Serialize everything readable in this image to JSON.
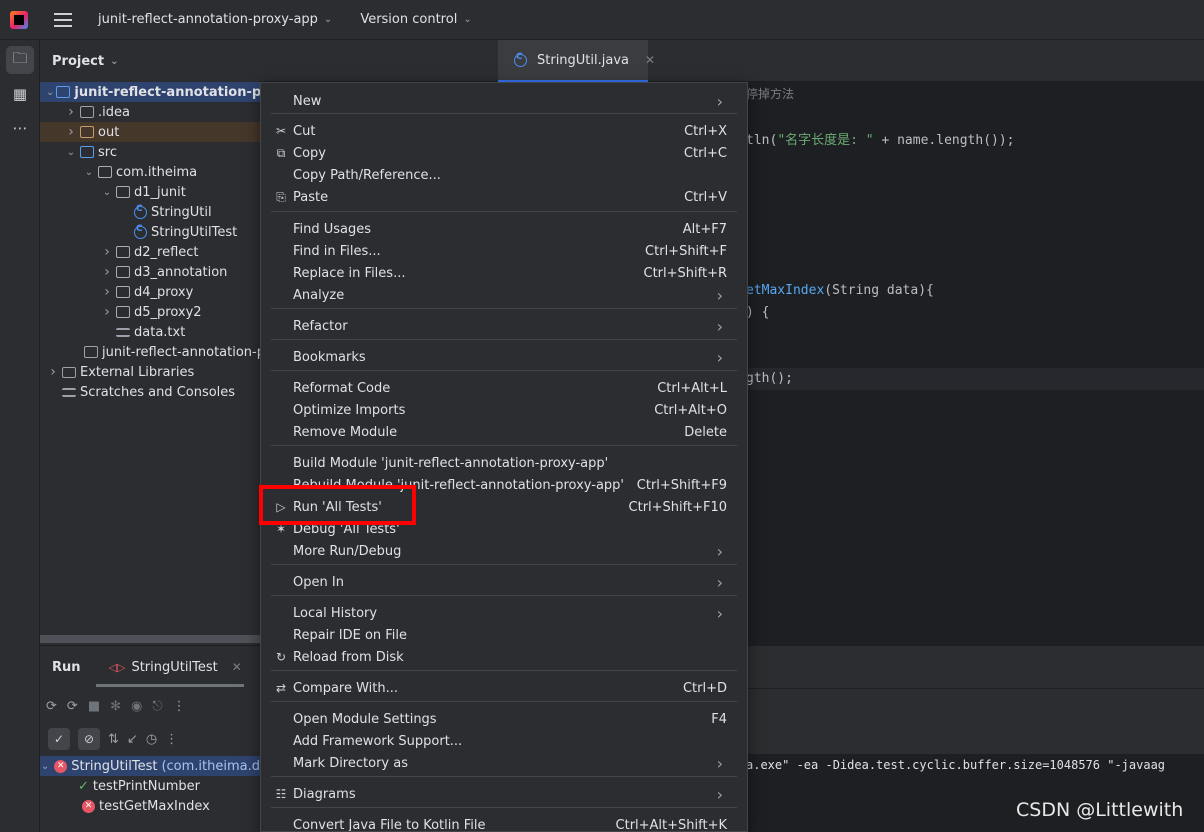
{
  "topbar": {
    "project_name": "junit-reflect-annotation-proxy-app",
    "vcs_label": "Version control"
  },
  "project_panel": {
    "title": "Project",
    "tree": [
      {
        "label": "junit-reflect-annotation-p",
        "depth": 0,
        "expanded": true,
        "icon": "module-folder-icon",
        "selected": true
      },
      {
        "label": ".idea",
        "depth": 1,
        "expanded": false,
        "icon": "folder-icon"
      },
      {
        "label": "out",
        "depth": 1,
        "expanded": false,
        "icon": "folder-orange-icon",
        "highlight": true
      },
      {
        "label": "src",
        "depth": 1,
        "expanded": true,
        "icon": "source-folder-icon"
      },
      {
        "label": "com.itheima",
        "depth": 2,
        "expanded": true,
        "icon": "package-icon"
      },
      {
        "label": "d1_junit",
        "depth": 3,
        "expanded": true,
        "icon": "package-icon"
      },
      {
        "label": "StringUtil",
        "depth": 4,
        "icon": "class-icon"
      },
      {
        "label": "StringUtilTest",
        "depth": 4,
        "icon": "class-icon"
      },
      {
        "label": "d2_reflect",
        "depth": 3,
        "expanded": false,
        "icon": "package-icon"
      },
      {
        "label": "d3_annotation",
        "depth": 3,
        "expanded": false,
        "icon": "package-icon"
      },
      {
        "label": "d4_proxy",
        "depth": 3,
        "expanded": false,
        "icon": "package-icon"
      },
      {
        "label": "d5_proxy2",
        "depth": 3,
        "expanded": false,
        "icon": "package-icon"
      },
      {
        "label": "data.txt",
        "depth": 3,
        "icon": "text-file-icon"
      },
      {
        "label": "junit-reflect-annotation-p",
        "depth": 2,
        "icon": "module-file-icon"
      },
      {
        "label": "External Libraries",
        "depth": 0,
        "expanded": false,
        "icon": "library-icon"
      },
      {
        "label": "Scratches and Consoles",
        "depth": 0,
        "icon": "scratches-icon"
      }
    ]
  },
  "editor": {
    "tab_label": "StringUtil.java",
    "code": {
      "line1": "停掉方法",
      "line2_pre": "tln(",
      "line2_str": "\"名字长度是: \"",
      "line2_post": " + name.length());",
      "line3_fn": "etMaxIndex",
      "line3_post": "(String data){",
      "line4": ") {",
      "line5": "gth();"
    }
  },
  "context_menu": {
    "items": [
      {
        "label": "New",
        "shortcut": "",
        "submenu": true,
        "icon": ""
      },
      {
        "label": "Cut",
        "shortcut": "Ctrl+X",
        "icon": "scissors-icon"
      },
      {
        "label": "Copy",
        "shortcut": "Ctrl+C",
        "icon": "copy-icon"
      },
      {
        "label": "Copy Path/Reference...",
        "shortcut": "",
        "icon": ""
      },
      {
        "label": "Paste",
        "shortcut": "Ctrl+V",
        "icon": "paste-icon"
      },
      {
        "label": "Find Usages",
        "shortcut": "Alt+F7",
        "icon": ""
      },
      {
        "label": "Find in Files...",
        "shortcut": "Ctrl+Shift+F",
        "icon": ""
      },
      {
        "label": "Replace in Files...",
        "shortcut": "Ctrl+Shift+R",
        "icon": ""
      },
      {
        "label": "Analyze",
        "shortcut": "",
        "submenu": true,
        "icon": ""
      },
      {
        "label": "Refactor",
        "shortcut": "",
        "submenu": true,
        "icon": ""
      },
      {
        "label": "Bookmarks",
        "shortcut": "",
        "submenu": true,
        "icon": ""
      },
      {
        "label": "Reformat Code",
        "shortcut": "Ctrl+Alt+L",
        "icon": ""
      },
      {
        "label": "Optimize Imports",
        "shortcut": "Ctrl+Alt+O",
        "icon": ""
      },
      {
        "label": "Remove Module",
        "shortcut": "Delete",
        "icon": ""
      },
      {
        "label": "Build Module 'junit-reflect-annotation-proxy-app'",
        "shortcut": "",
        "icon": ""
      },
      {
        "label": "Rebuild Module 'junit-reflect-annotation-proxy-app'",
        "shortcut": "Ctrl+Shift+F9",
        "icon": ""
      },
      {
        "label": "Run 'All Tests'",
        "shortcut": "Ctrl+Shift+F10",
        "icon": "run-icon"
      },
      {
        "label": "Debug 'All Tests'",
        "shortcut": "",
        "icon": "debug-icon"
      },
      {
        "label": "More Run/Debug",
        "shortcut": "",
        "submenu": true,
        "icon": ""
      },
      {
        "label": "Open In",
        "shortcut": "",
        "submenu": true,
        "icon": ""
      },
      {
        "label": "Local History",
        "shortcut": "",
        "submenu": true,
        "icon": ""
      },
      {
        "label": "Repair IDE on File",
        "shortcut": "",
        "icon": ""
      },
      {
        "label": "Reload from Disk",
        "shortcut": "",
        "icon": "reload-icon"
      },
      {
        "label": "Compare With...",
        "shortcut": "Ctrl+D",
        "icon": "compare-icon"
      },
      {
        "label": "Open Module Settings",
        "shortcut": "F4",
        "icon": ""
      },
      {
        "label": "Add Framework Support...",
        "shortcut": "",
        "icon": ""
      },
      {
        "label": "Mark Directory as",
        "shortcut": "",
        "submenu": true,
        "icon": ""
      },
      {
        "label": "Diagrams",
        "shortcut": "",
        "submenu": true,
        "icon": "diagram-icon"
      },
      {
        "label": "Convert Java File to Kotlin File",
        "shortcut": "Ctrl+Alt+Shift+K",
        "icon": ""
      }
    ]
  },
  "run_panel": {
    "title": "Run",
    "tab_label": "StringUtilTest",
    "tests": [
      {
        "label": "StringUtilTest",
        "suffix": "(com.itheima.d",
        "status": "failed"
      },
      {
        "label": "testPrintNumber",
        "status": "passed"
      },
      {
        "label": "testGetMaxIndex",
        "status": "failed"
      }
    ],
    "console_line": "a.exe\" -ea -Didea.test.cyclic.buffer.size=1048576 \"-javaag"
  },
  "watermark": "CSDN @Littlewith"
}
